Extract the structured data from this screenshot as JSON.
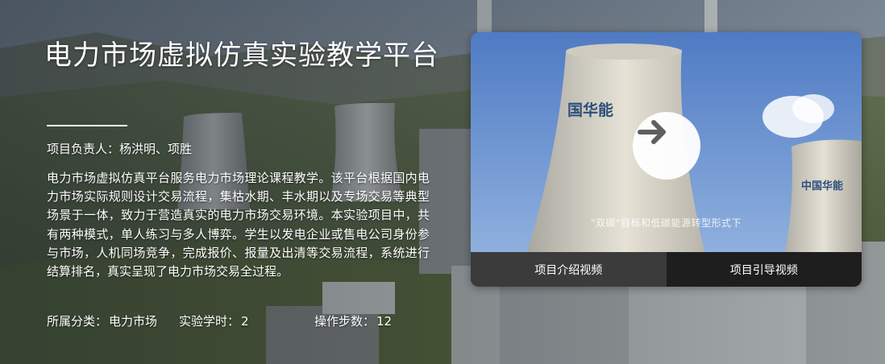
{
  "project": {
    "title": "电力市场虚拟仿真实验教学平台",
    "leader_label": "项目负责人：",
    "leader_value": "杨洪明、项胜",
    "description": "电力市场虚拟仿真平台服务电力市场理论课程教学。该平台根据国内电力市场实际规则设计交易流程，集枯水期、丰水期以及专场交易等典型场景于一体，致力于营造真实的电力市场交易环境。本实验项目中，共有两种模式，单人练习与多人博弈。学生以发电企业或售电公司身份参与市场，人机同场竞争，完成报价、报量及出清等交易流程，系统进行结算排名，真实呈现了电力市场交易全过程。",
    "category_label": "所属分类：",
    "category_value": "电力市场",
    "hours_label": "实验学时：",
    "hours_value": "2",
    "steps_label": "操作步数：",
    "steps_value": "12"
  },
  "video": {
    "tower_brand": "国华能",
    "tower_brand_right": "中国华能",
    "caption": "\"双碳\"目标和低碳能源转型形式下",
    "play_icon": "arrow-right-icon",
    "tabs": [
      {
        "label": "项目介绍视频"
      },
      {
        "label": "项目引导视频"
      }
    ]
  },
  "colors": {
    "sky": "#6f93c9",
    "tab_active": "#3b3b3b",
    "tab_inactive": "#1e1e1e"
  }
}
